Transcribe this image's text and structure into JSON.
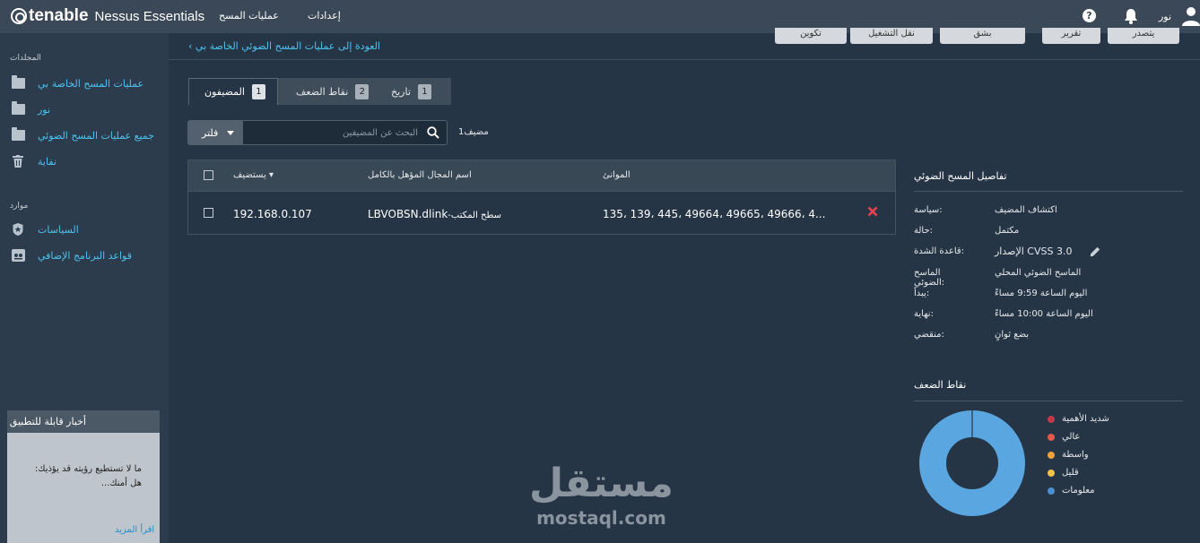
{
  "header": {
    "brand": "tenable",
    "product": "Nessus Essentials",
    "nav": {
      "scans": "عمليات المسح",
      "settings": "إعدادات"
    },
    "user": "نور"
  },
  "sidebar": {
    "folders_heading": "المجلدات",
    "folders": [
      {
        "label": "عمليات المسح الخاصة بي",
        "icon": "folder-icon"
      },
      {
        "label": "نور",
        "icon": "folder-icon"
      },
      {
        "label": "جميع عمليات المسح الضوئي",
        "icon": "folder-icon"
      },
      {
        "label": "نفاية",
        "icon": "trash-icon"
      }
    ],
    "resources_heading": "موارد",
    "resources": [
      {
        "label": "السياسات",
        "icon": "policy-star-icon"
      },
      {
        "label": "قواعد البرنامج الإضافي",
        "icon": "plugin-rules-icon"
      }
    ],
    "news": {
      "title": "أخبار قابلة للتطبيق",
      "text": "ما لا تستطيع رؤيته قد يؤذيك: هل أمنك...",
      "more": "اقرأ المزيد"
    }
  },
  "main": {
    "back_link": "العودة إلى عمليات المسح الضوئي الخاصة بي",
    "actions": [
      "تكوين",
      "نقل التشغيل",
      "بشق",
      "تقرير",
      "يتصدر"
    ],
    "tabs": [
      {
        "label": "المضيفون",
        "count": "1"
      },
      {
        "label": "نقاط الضعف",
        "count": "2"
      },
      {
        "label": "تاريخ",
        "count": "1"
      }
    ],
    "filter_label": "فلتر",
    "search_placeholder": "البحث عن المضيفين",
    "host_count": "مضيف1",
    "table": {
      "columns": {
        "host": "يستضيف",
        "fqdn": "اسم المجال المؤهل بالكامل",
        "ports": "الموانئ"
      },
      "rows": [
        {
          "host": "192.168.0.107",
          "fqdn_prefix": "LBVOBSN.dlink",
          "fqdn_suffix": "-سطح المكتب",
          "ports": "135، 139، 445، 49664، 49665، 49666، 4..."
        }
      ]
    }
  },
  "details": {
    "title": "تفاصيل المسح الضوئي",
    "rows": [
      {
        "key": "سياسة:",
        "value": "اكتشاف المضيف"
      },
      {
        "key": "حالة:",
        "value": "مكتمل"
      },
      {
        "key": "قاعدة الشدة:",
        "value": "الإصدار CVSS 3.0"
      },
      {
        "key": "الماسح الضوئي:",
        "value": "الماسح الضوئي المحلي"
      },
      {
        "key": "يبدأ:",
        "value": "اليوم الساعة 9:59 مساءً"
      },
      {
        "key": "نهاية:",
        "value": "اليوم الساعة 10:00 مساءً"
      },
      {
        "key": "منقضي:",
        "value": "بضع ثوانٍ"
      }
    ]
  },
  "vulnerabilities": {
    "title": "نقاط الضعف",
    "legend": [
      {
        "label": "شديد الأهمية",
        "color": "#c03a48"
      },
      {
        "label": "عالي",
        "color": "#e35a4a"
      },
      {
        "label": "واسطة",
        "color": "#f0a23b"
      },
      {
        "label": "قليل",
        "color": "#f2c24b"
      },
      {
        "label": "معلومات",
        "color": "#4c8fd0"
      }
    ],
    "chart_data": {
      "type": "pie",
      "categories": [
        "شديد الأهمية",
        "عالي",
        "واسطة",
        "قليل",
        "معلومات"
      ],
      "values": [
        0,
        0,
        0,
        0,
        100
      ]
    }
  },
  "watermark": {
    "arabic": "مستقل",
    "latin": "mostaql.com"
  }
}
